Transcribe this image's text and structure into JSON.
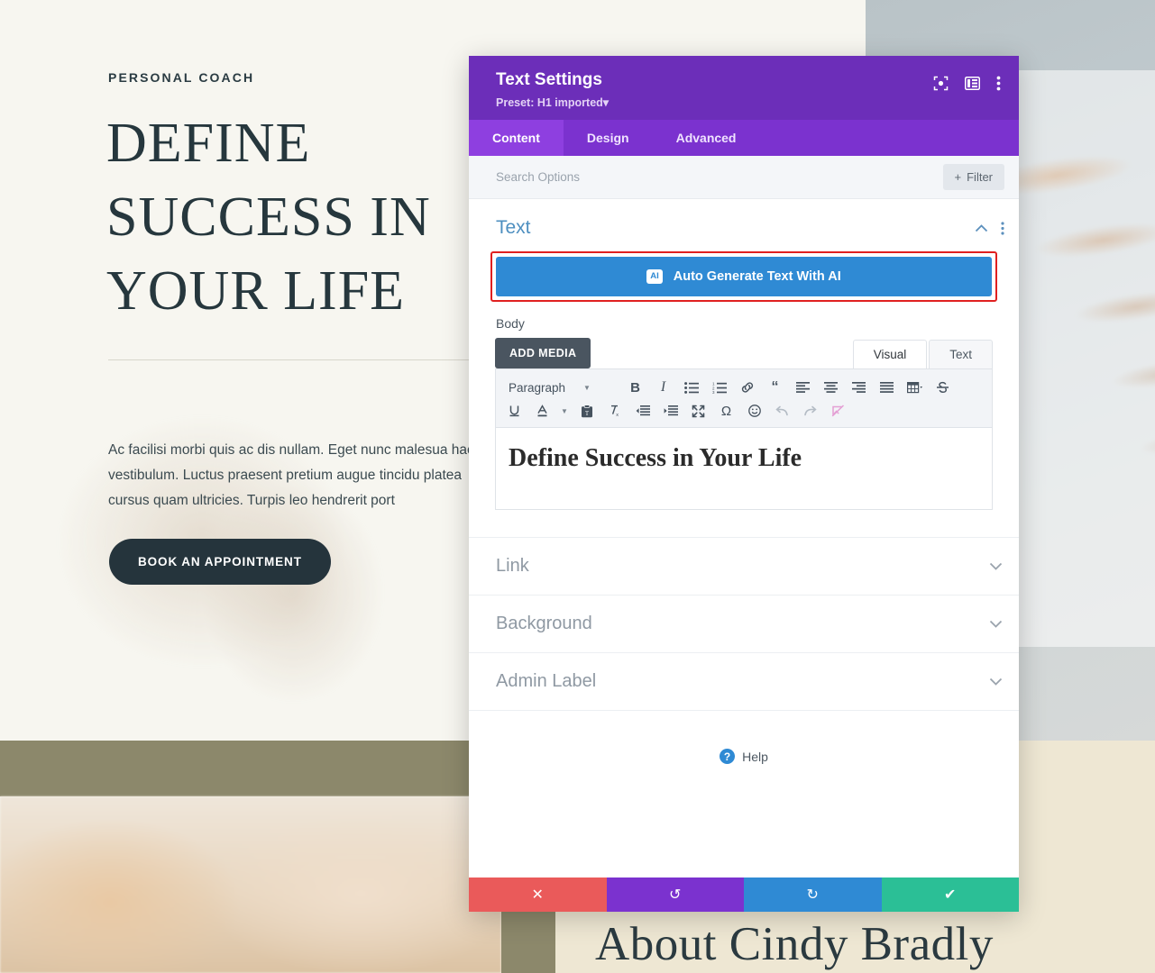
{
  "website": {
    "eyebrow": "PERSONAL COACH",
    "headline": "DEFINE SUCCESS IN YOUR LIFE",
    "body": "Ac facilisi morbi quis ac dis nullam. Eget nunc malesua hac vestibulum. Luctus praesent pretium augue tincidu platea cursus quam ultricies. Turpis leo hendrerit port",
    "cta_label": "BOOK AN APPOINTMENT",
    "about_title": "About Cindy Bradly",
    "colors": {
      "hero_bg": "#f7f6f0",
      "heading": "#26373d",
      "cta_bg": "#25343c",
      "olive_band": "#8c886b",
      "cream": "#eee7d3"
    }
  },
  "modal": {
    "title": "Text Settings",
    "preset": "Preset: H1 imported",
    "preset_caret": "▾",
    "header_icons": [
      {
        "name": "focus-icon",
        "label": "focus"
      },
      {
        "name": "layout-panel-icon",
        "label": "layout"
      },
      {
        "name": "more-vertical-icon",
        "label": "more"
      }
    ],
    "tabs": [
      {
        "label": "Content",
        "active": true
      },
      {
        "label": "Design",
        "active": false
      },
      {
        "label": "Advanced",
        "active": false
      }
    ],
    "search": {
      "placeholder": "Search Options",
      "filter_label": "Filter",
      "filter_icon": "plus-icon"
    },
    "section": {
      "title": "Text",
      "collapse_icon": "chevron-up-icon",
      "menu_icon": "more-vertical-icon"
    },
    "ai_button": {
      "label": "Auto Generate Text With AI",
      "badge": "AI",
      "bg": "#2f8ad4",
      "highlight_border": "#e02020"
    },
    "field": {
      "label": "Body",
      "add_media_label": "ADD MEDIA",
      "editor_tabs": [
        {
          "label": "Visual",
          "active": true
        },
        {
          "label": "Text",
          "active": false
        }
      ],
      "format_select": "Paragraph",
      "toolbar_row1": [
        "bold-icon",
        "italic-icon",
        "bulleted-list-icon",
        "numbered-list-icon",
        "link-icon",
        "blockquote-icon",
        "align-left-icon",
        "align-center-icon",
        "align-right-icon",
        "align-justify-icon",
        "table-icon",
        "strikethrough-icon"
      ],
      "toolbar_row2": [
        "underline-icon",
        "text-color-icon",
        "paste-as-text-icon",
        "clear-formatting-icon",
        "outdent-icon",
        "indent-icon",
        "fullscreen-icon",
        "special-character-icon",
        "emoji-icon",
        "undo-icon",
        "redo-icon",
        "no-image-icon"
      ],
      "content": "Define Success in Your Life"
    },
    "accordion": [
      {
        "label": "Link",
        "icon": "chevron-down-icon"
      },
      {
        "label": "Background",
        "icon": "chevron-down-icon"
      },
      {
        "label": "Admin Label",
        "icon": "chevron-down-icon"
      }
    ],
    "help_label": "Help",
    "help_icon": "question-mark-icon",
    "footer": [
      {
        "name": "cancel-button",
        "icon": "close-icon",
        "glyph": "✕",
        "color": "#ea5a5a"
      },
      {
        "name": "undo-button",
        "icon": "undo-icon",
        "glyph": "↺",
        "color": "#7b32cf"
      },
      {
        "name": "redo-button",
        "icon": "redo-icon",
        "glyph": "↻",
        "color": "#2f8ad4"
      },
      {
        "name": "save-button",
        "icon": "check-icon",
        "glyph": "✔",
        "color": "#2bbf96"
      }
    ]
  }
}
